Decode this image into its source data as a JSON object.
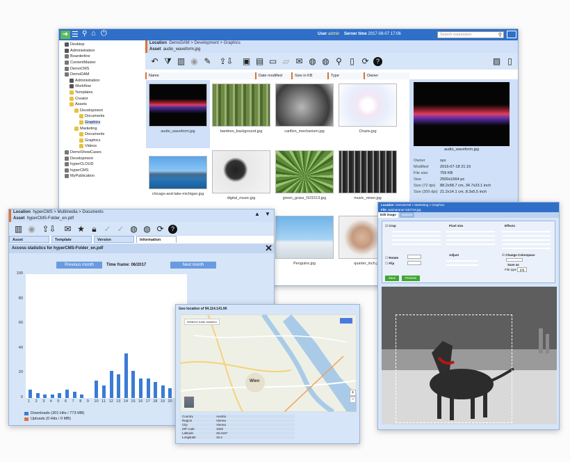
{
  "main": {
    "user_label": "User",
    "user": "admin",
    "server_time_label": "Server time",
    "server_time": "2017-08-07 17:06",
    "search_placeholder": "Search expression",
    "location_label": "Location",
    "location": "DemoDAM > Development > Graphics",
    "asset_label": "Asset",
    "asset": "audio_waveform.jpg",
    "columns": [
      "Name",
      "Date modified",
      "Size in KB",
      "Type",
      "Owner"
    ],
    "tree": [
      {
        "label": "Desktop",
        "indent": 0,
        "color": "#555"
      },
      {
        "label": "Administration",
        "indent": 0,
        "color": "#555"
      },
      {
        "label": "Boarderline",
        "indent": 0,
        "color": "#777"
      },
      {
        "label": "ContentMaster",
        "indent": 0,
        "color": "#777"
      },
      {
        "label": "DemoCMS",
        "indent": 0,
        "color": "#777"
      },
      {
        "label": "DemoDAM",
        "indent": 0,
        "color": "#777"
      },
      {
        "label": "Administration",
        "indent": 1,
        "color": "#555"
      },
      {
        "label": "Workflow",
        "indent": 1,
        "color": "#555"
      },
      {
        "label": "Templates",
        "indent": 1,
        "color": "#e8c040"
      },
      {
        "label": "Creator",
        "indent": 1,
        "color": "#e8c040"
      },
      {
        "label": "Assets",
        "indent": 1,
        "color": "#e8c040"
      },
      {
        "label": "Development",
        "indent": 2,
        "color": "#e8c040"
      },
      {
        "label": "Documents",
        "indent": 3,
        "color": "#e8c040"
      },
      {
        "label": "Graphics",
        "indent": 3,
        "color": "#e8c040"
      },
      {
        "label": "Marketing",
        "indent": 2,
        "color": "#e8c040"
      },
      {
        "label": "Documents",
        "indent": 3,
        "color": "#e8c040"
      },
      {
        "label": "Graphics",
        "indent": 3,
        "color": "#e8c040"
      },
      {
        "label": "Videos",
        "indent": 3,
        "color": "#e8c040"
      },
      {
        "label": "DemoShowCases",
        "indent": 0,
        "color": "#777"
      },
      {
        "label": "Development",
        "indent": 0,
        "color": "#777"
      },
      {
        "label": "hyperCLOUD",
        "indent": 0,
        "color": "#777"
      },
      {
        "label": "hyperCMS",
        "indent": 0,
        "color": "#777"
      },
      {
        "label": "MyPublication",
        "indent": 0,
        "color": "#777"
      }
    ],
    "thumbs": [
      {
        "name": "audio_waveform.jpg"
      },
      {
        "name": "bamboo_background.jpg"
      },
      {
        "name": "carillon_mechanism.jpg"
      },
      {
        "name": "Charts.jpg"
      },
      {
        "name": "chicago-and-lake-michigan.jpg"
      },
      {
        "name": "digital_music.jpg"
      },
      {
        "name": "green_grass_f101513.jpg"
      },
      {
        "name": "music_mixer.jpg"
      },
      {
        "name": "Penguins.jpg"
      },
      {
        "name": "quarter_inch.jpg"
      }
    ],
    "preview_caption": "audio_waveform.jpg",
    "info": [
      {
        "k": "Owner",
        "v": "sys"
      },
      {
        "k": "Modified",
        "v": "2016-07-18 21:19"
      },
      {
        "k": "File size",
        "v": "759 KB"
      },
      {
        "k": "Size",
        "v": "2500x1664 px"
      },
      {
        "k": "Size (72 dpi)",
        "v": "88.2x58.7 cm, 34.7x23.1 inch"
      },
      {
        "k": "Size (300 dpi)",
        "v": "21.2x14.1 cm, 8.3x5.5 inch"
      }
    ]
  },
  "stats": {
    "location_label": "Location",
    "location": "hyperCMS > Multimedia > Documents",
    "asset_label": "Asset",
    "asset": "hyperCMS-Folder_en.pdf",
    "tabs": [
      "Asset",
      "Template",
      "Version",
      "Information"
    ],
    "title": "Access statistics for hyperCMS-Folder_en.pdf",
    "prev_label": "Previous month",
    "timeframe": "Time frame: 06/2017",
    "next_label": "Next month",
    "legend_downloads": "Downloads (301 Hits / 773 MB)",
    "legend_uploads": "Uploads (0 Hits / 0 MB)"
  },
  "chart_data": {
    "type": "bar",
    "categories": [
      "1",
      "2",
      "3",
      "4",
      "5",
      "6",
      "7",
      "8",
      "9",
      "10",
      "11",
      "12",
      "13",
      "14",
      "15",
      "16",
      "17",
      "18",
      "19",
      "20"
    ],
    "series": [
      {
        "name": "Downloads (301 Hits / 773 MB)",
        "values": [
          7,
          4,
          3,
          3,
          4,
          7,
          5,
          3,
          0,
          14,
          10,
          22,
          19,
          36,
          22,
          16,
          16,
          13,
          10,
          8
        ]
      },
      {
        "name": "Uploads (0 Hits / 0 MB)",
        "values": [
          0,
          0,
          0,
          0,
          0,
          0,
          0,
          0,
          0,
          0,
          0,
          0,
          0,
          0,
          0,
          0,
          0,
          0,
          0,
          0
        ]
      }
    ],
    "yticks": [
      0,
      20,
      40,
      60,
      80,
      100
    ],
    "ylim": [
      0,
      100
    ],
    "colors": {
      "downloads": "#3a7bd5",
      "uploads": "#e07030"
    }
  },
  "geo": {
    "title": "Geo location of 94.114.141.96",
    "map_button": "Weiteres Karte ansehen",
    "city_label": "Wien",
    "rows": [
      {
        "k": "Country",
        "v": "Austria"
      },
      {
        "k": "Region",
        "v": "Vienna"
      },
      {
        "k": "City",
        "v": "Vienna"
      },
      {
        "k": "ZIP code",
        "v": "1020"
      },
      {
        "k": "Latitude",
        "v": "48.2167"
      },
      {
        "k": "Longitude",
        "v": "16.4"
      }
    ]
  },
  "editor": {
    "location_label": "Location",
    "location": "DemoDAM > Marketing > Graphics",
    "file_label": "File",
    "file": "weimaraner-540734.jpg",
    "tabs": [
      "Edit image",
      "Options"
    ],
    "crop_label": "Crop",
    "pixel_size_label": "Pixel size",
    "effects_label": "Effects",
    "rotate_label": "Rotate",
    "flip_label": "Flip",
    "adjust_label": "Adjust",
    "change_colorspace_label": "Change Colorspace",
    "save_as_label": "Save as",
    "file_type_label": "File type",
    "file_type": "jpg",
    "save_label": "Save",
    "preview_label": "Preview"
  }
}
